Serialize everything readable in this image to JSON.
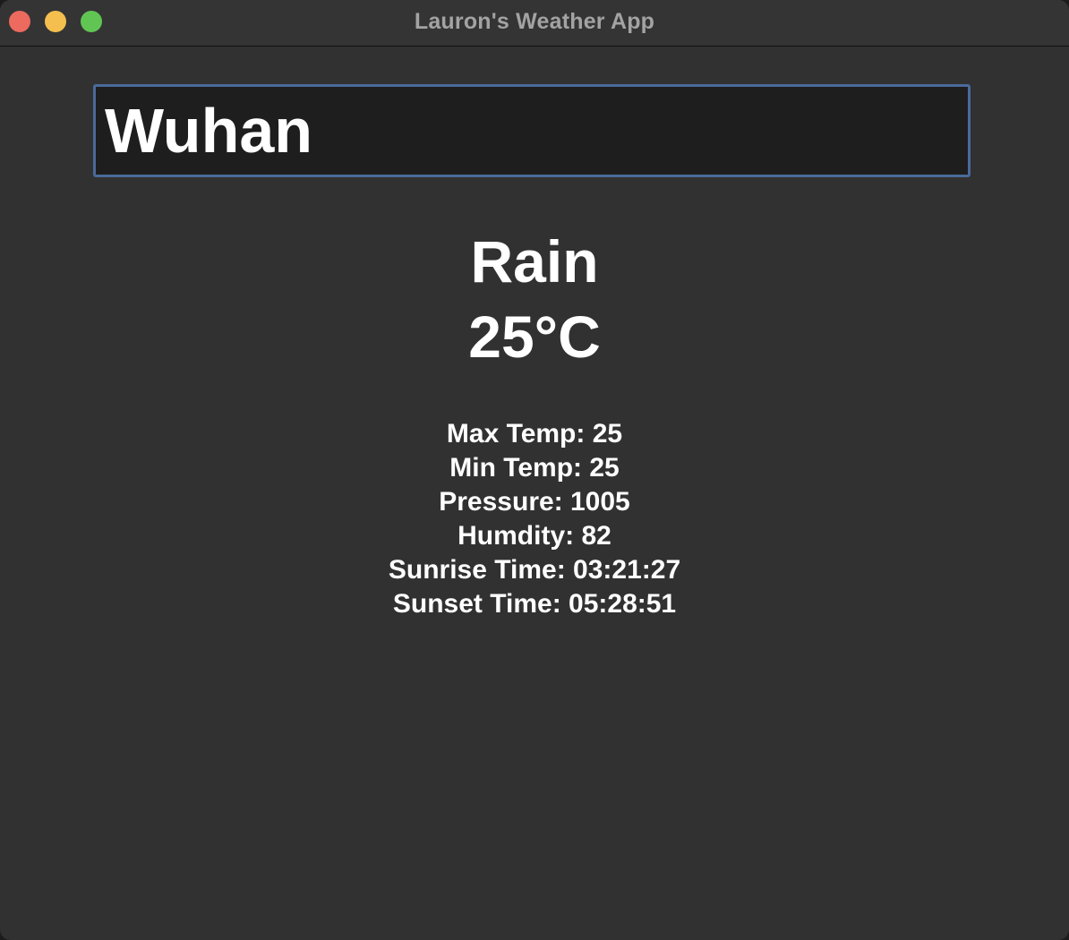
{
  "window": {
    "title": "Lauron's Weather App"
  },
  "search": {
    "value": "Wuhan"
  },
  "weather": {
    "condition": "Rain",
    "temperature": "25°C"
  },
  "details": [
    "Max Temp: 25",
    "Min Temp: 25",
    "Pressure: 1005",
    "Humdity: 82",
    "Sunrise Time: 03:21:27",
    "Sunset Time: 05:28:51"
  ],
  "colors": {
    "window_bg": "#313131",
    "input_bg": "#1e1e1e",
    "input_focus_border": "#4a6a9a",
    "close": "#ec6a5e",
    "minimize": "#f4bf4f",
    "zoom": "#61c554"
  }
}
